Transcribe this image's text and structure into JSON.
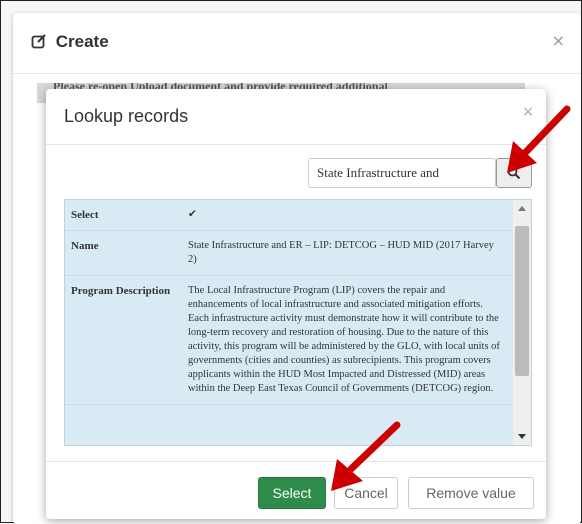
{
  "outer": {
    "title": "Create",
    "close": "×",
    "background_text": "Please re-open Upload document and provide required additional"
  },
  "lookup": {
    "title": "Lookup records",
    "close": "×",
    "search_value": "State Infrastructure and",
    "rows": [
      {
        "label": "Select",
        "value": "✔"
      },
      {
        "label": "Name",
        "value": "State Infrastructure and ER – LIP: DETCOG – HUD MID (2017 Harvey 2)"
      },
      {
        "label": "Program Description",
        "value": "The Local Infrastructure Program (LIP) covers the repair and enhancements of local infrastructure and associated mitigation efforts. Each infrastructure activity must demonstrate how it will contribute to the long-term recovery and restoration of housing. Due to the nature of this activity, this program will be administered by the GLO, with local units of governments (cities and counties) as subrecipients. This program covers applicants within the HUD Most Impacted and Distressed (MID) areas within the Deep East Texas Council of Governments (DETCOG) region."
      }
    ],
    "buttons": {
      "select": "Select",
      "cancel": "Cancel",
      "remove": "Remove value"
    }
  },
  "colors": {
    "primary_green": "#2e8b4a",
    "records_bg": "#d8ebf5",
    "annotation_red": "#cc0000"
  },
  "icons": {
    "create": "edit-square-icon",
    "search": "magnifier-icon"
  }
}
